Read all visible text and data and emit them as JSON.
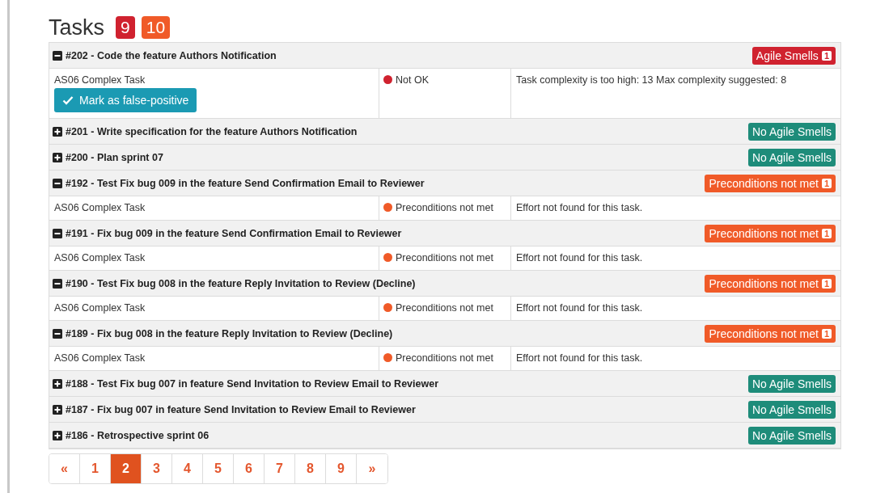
{
  "title": "Tasks",
  "counters": [
    {
      "label": "9",
      "color": "#d0222f"
    },
    {
      "label": "10",
      "color": "#f05a28"
    }
  ],
  "tasks": [
    {
      "expanded": true,
      "title": "#202 - Code the feature Authors Notification",
      "badge": {
        "kind": "smells",
        "label": "Agile Smells",
        "count": "1"
      },
      "details": [
        {
          "smell": "AS06 Complex Task",
          "action": "Mark as false-positive",
          "status": "Not OK",
          "color": "#d0222f",
          "message": "Task complexity is too high: 13 Max complexity suggested: 8"
        }
      ]
    },
    {
      "expanded": false,
      "title": "#201 - Write specification for the feature Authors Notification",
      "badge": {
        "kind": "ok",
        "label": "No Agile Smells"
      }
    },
    {
      "expanded": false,
      "title": "#200 - Plan sprint 07",
      "badge": {
        "kind": "ok",
        "label": "No Agile Smells"
      }
    },
    {
      "expanded": true,
      "title": "#192 - Test Fix bug 009 in the feature Send Confirmation Email to Reviewer",
      "badge": {
        "kind": "preconditions",
        "label": "Preconditions not met",
        "count": "1"
      },
      "details": [
        {
          "smell": "AS06 Complex Task",
          "status": "Preconditions not met",
          "color": "#f05a28",
          "message": "Effort not found for this task."
        }
      ]
    },
    {
      "expanded": true,
      "title": "#191 - Fix bug 009 in the feature Send Confirmation Email to Reviewer",
      "badge": {
        "kind": "preconditions",
        "label": "Preconditions not met",
        "count": "1"
      },
      "details": [
        {
          "smell": "AS06 Complex Task",
          "status": "Preconditions not met",
          "color": "#f05a28",
          "message": "Effort not found for this task."
        }
      ]
    },
    {
      "expanded": true,
      "title": "#190 - Test Fix bug 008 in the feature Reply Invitation to Review (Decline)",
      "badge": {
        "kind": "preconditions",
        "label": "Preconditions not met",
        "count": "1"
      },
      "details": [
        {
          "smell": "AS06 Complex Task",
          "status": "Preconditions not met",
          "color": "#f05a28",
          "message": "Effort not found for this task."
        }
      ]
    },
    {
      "expanded": true,
      "title": "#189 - Fix bug 008 in the feature Reply Invitation to Review (Decline)",
      "badge": {
        "kind": "preconditions",
        "label": "Preconditions not met",
        "count": "1"
      },
      "details": [
        {
          "smell": "AS06 Complex Task",
          "status": "Preconditions not met",
          "color": "#f05a28",
          "message": "Effort not found for this task."
        }
      ]
    },
    {
      "expanded": false,
      "title": "#188 - Test Fix bug 007 in feature Send Invitation to Review Email to Reviewer",
      "badge": {
        "kind": "ok",
        "label": "No Agile Smells"
      }
    },
    {
      "expanded": false,
      "title": "#187 - Fix bug 007 in feature Send Invitation to Review Email to Reviewer",
      "badge": {
        "kind": "ok",
        "label": "No Agile Smells"
      }
    },
    {
      "expanded": false,
      "title": "#186 - Retrospective sprint 06",
      "badge": {
        "kind": "ok",
        "label": "No Agile Smells"
      }
    }
  ],
  "pagination": [
    {
      "label": "«",
      "selected": false
    },
    {
      "label": "1",
      "selected": false
    },
    {
      "label": "2",
      "selected": true
    },
    {
      "label": "3",
      "selected": false
    },
    {
      "label": "4",
      "selected": false
    },
    {
      "label": "5",
      "selected": false
    },
    {
      "label": "6",
      "selected": false
    },
    {
      "label": "7",
      "selected": false
    },
    {
      "label": "8",
      "selected": false
    },
    {
      "label": "9",
      "selected": false
    },
    {
      "label": "»",
      "selected": false
    }
  ]
}
